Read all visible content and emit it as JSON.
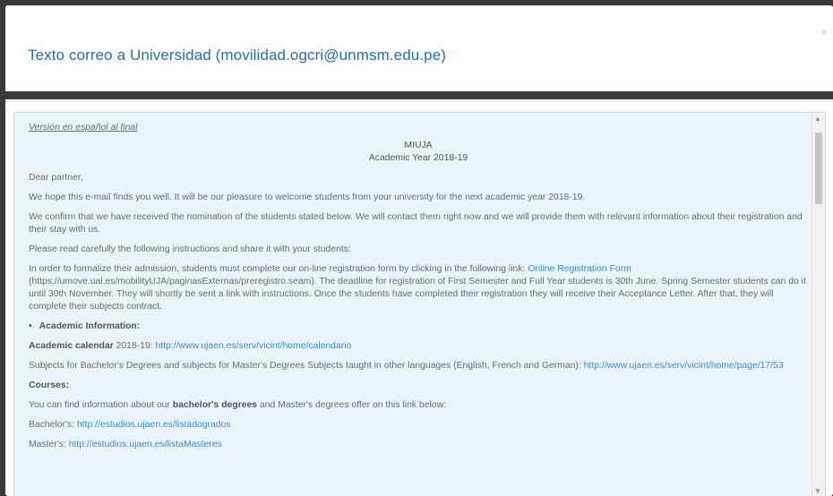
{
  "modal": {
    "title": "Texto correo a Universidad (movilidad.ogcri@unmsm.edu.pe)",
    "close_label": "×"
  },
  "email": {
    "intro": "Versión en español al final",
    "heading_line1": "MIUJA",
    "heading_line2": "Academic Year 2018-19",
    "greeting": "Dear partner,",
    "p1": "We hope this e-mail finds you well. It will be our pleasure to welcome students from your university for the next academic year 2018-19.",
    "p2": "We confirm that we have received the nomination of the students stated below. We will contact them right now and we will provide them with relevant information about their registration and their stay with us.",
    "p3": "Please read carefully the following instructions and share it with your students:",
    "p4_before_link": "In order to formalize their admission, students must complete our on-line registration form by clicking in the following link: ",
    "p4_link": "Online Registration Form",
    "p4_after_link": " (https://umove.ual.es/mobilityUJA/paginasExternas/preregistro.seam). The deadline for registration of First Semester and Full Year students is 30th June. Spring Semester students can do it until 30th November. They will shortly be sent a link with instructions. Once the students have completed their registration they will receive their Acceptance Letter. After that, they will complete their subjects contract.",
    "bullet_academic_info": "Academic Information:",
    "calendar_label": "Academic calendar",
    "calendar_year": " 2018-19: ",
    "calendar_link": "http://www.ujaen.es/serv/vicint/home/calendario",
    "subjects_text": "Subjects for Bachelor's Degrees and subjects for Master's Degrees Subjects taught in other languages (English, French and German): ",
    "subjects_link": "http://www.ujaen.es/serv/vicint/home/page/17/53",
    "courses_label": "Courses:",
    "courses_before": "You can find information about our ",
    "courses_bold": "bachelor's degrees",
    "courses_after": " and Master's degrees offer on this link below:",
    "bachelors_label": "Bachelor's: ",
    "bachelors_link": "http://estudios.ujaen.es/listadogrados",
    "masters_label": "Master's: ",
    "masters_link": "http://estudios.ujaen.es/listaMasteres"
  },
  "scrollbar": {
    "up_icon": "▲",
    "down_icon": "▼"
  }
}
